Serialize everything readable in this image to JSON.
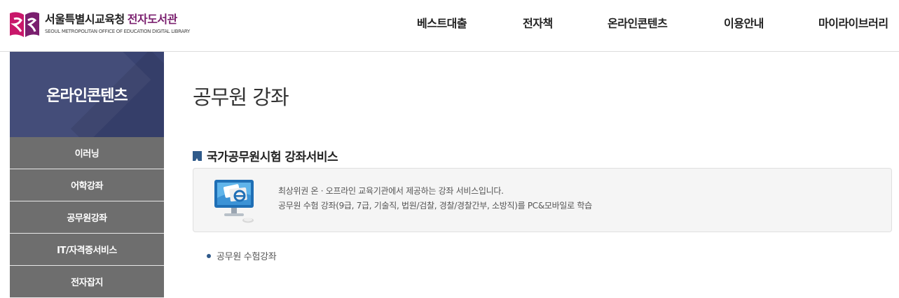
{
  "logo": {
    "org_name": "서울특별시교육청",
    "library_name": "전자도서관",
    "subtitle": "SEOUL METROPOLITAN OFFICE OF EDUCATION DIGITAL LIBRARY"
  },
  "gnb": {
    "items": [
      {
        "label": "베스트대출"
      },
      {
        "label": "전자책"
      },
      {
        "label": "온라인콘텐츠"
      },
      {
        "label": "이용안내"
      },
      {
        "label": "마이라이브러리"
      }
    ]
  },
  "sidebar": {
    "title": "온라인콘텐츠",
    "items": [
      {
        "label": "이러닝"
      },
      {
        "label": "어학강좌"
      },
      {
        "label": "공무원강좌"
      },
      {
        "label": "IT/자격증서비스"
      },
      {
        "label": "전자잡지"
      }
    ]
  },
  "main": {
    "page_title": "공무원 강좌",
    "section_title": "국가공무원시험 강좌서비스",
    "info_lines": [
      "최상위권 온 · 오프라인 교육기관에서 제공하는 강좌 서비스입니다.",
      "공무원 수험 강좌(9급, 7급, 기술직, 법원/검찰, 경찰/경찰간부, 소방직)를 PC&모바일로 학습"
    ],
    "links": [
      {
        "label": "공무원 수험강좌"
      }
    ]
  },
  "colors": {
    "sidebar_head": "#3a4472",
    "sidebar_item": "#6e6e6e",
    "accent_blue": "#2f5a8a",
    "logo_purple": "#7a1f6e",
    "logo_pink": "#c8176a"
  }
}
